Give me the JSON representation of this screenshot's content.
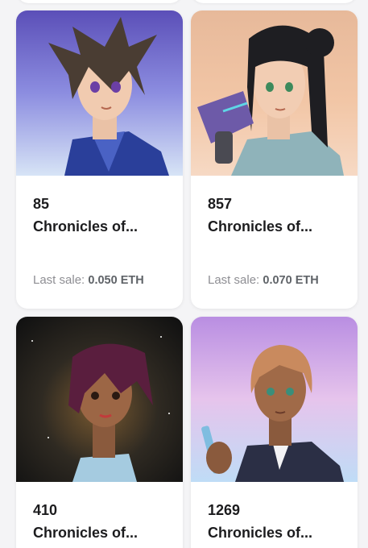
{
  "cards": [
    {
      "token_id": "85",
      "collection": "Chronicles of...",
      "last_sale_label": "Last sale:",
      "last_sale_value": "0.050 ETH"
    },
    {
      "token_id": "857",
      "collection": "Chronicles of...",
      "last_sale_label": "Last sale:",
      "last_sale_value": "0.070 ETH"
    },
    {
      "token_id": "410",
      "collection": "Chronicles of..."
    },
    {
      "token_id": "1269",
      "collection": "Chronicles of..."
    }
  ],
  "colors": {
    "page_background": "#f4f4f6",
    "card_background": "#ffffff",
    "text_primary": "#1c1c1e",
    "text_muted": "#8e8e93"
  }
}
